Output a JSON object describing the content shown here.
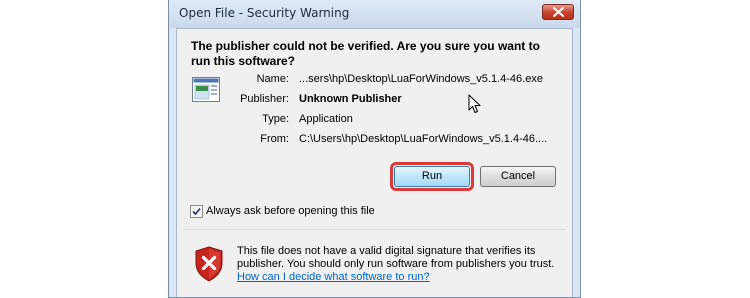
{
  "window": {
    "title": "Open File - Security Warning"
  },
  "heading": "The publisher could not be verified.  Are you sure you want to run this software?",
  "details": [
    {
      "label": "Name:",
      "value": "...sers\\hp\\Desktop\\LuaForWindows_v5.1.4-46.exe",
      "bold": false
    },
    {
      "label": "Publisher:",
      "value": "Unknown Publisher",
      "bold": true
    },
    {
      "label": "Type:",
      "value": "Application",
      "bold": false
    },
    {
      "label": "From:",
      "value": "C:\\Users\\hp\\Desktop\\LuaForWindows_v5.1.4-46....",
      "bold": false
    }
  ],
  "buttons": {
    "run": "Run",
    "cancel": "Cancel"
  },
  "checkbox": {
    "label": "Always ask before opening this file",
    "checked": true
  },
  "warning": {
    "text": "This file does not have a valid digital signature that verifies its publisher.  You should only run software from publishers you trust.",
    "link": "How can I decide what software to run?"
  },
  "colors": {
    "highlight_border": "#d93a3a",
    "link": "#0066cc",
    "shield_red": "#c8241c"
  },
  "icons": [
    "close-icon",
    "application-icon",
    "mouse-cursor-icon",
    "checkmark-icon",
    "warning-shield-icon"
  ]
}
